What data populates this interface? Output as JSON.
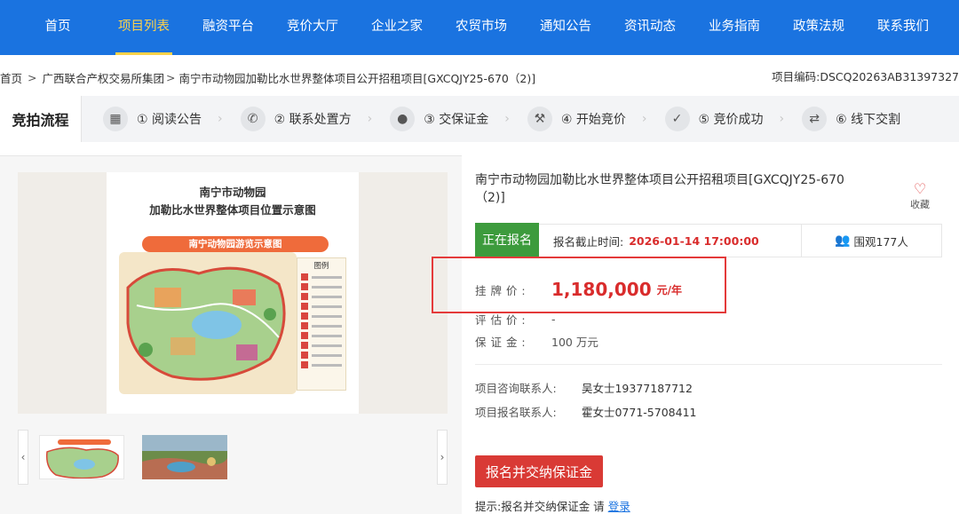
{
  "nav": {
    "items": [
      "首页",
      "项目列表",
      "融资平台",
      "竞价大厅",
      "企业之家",
      "农贸市场",
      "通知公告",
      "资讯动态",
      "业务指南",
      "政策法规",
      "联系我们"
    ],
    "active_index": 1
  },
  "breadcrumb": {
    "home": "首页",
    "group": "广西联合产权交易所集团",
    "current": "南宁市动物园加勒比水世界整体项目公开招租项目[GXCQJY25-670（2)]",
    "code": "项目编码:DSCQ20263AB31397327"
  },
  "flow": {
    "title": "竞拍流程",
    "steps": [
      {
        "label": "① 阅读公告",
        "icon": "announcement-icon"
      },
      {
        "label": "② 联系处置方",
        "icon": "phone-icon"
      },
      {
        "label": "③ 交保证金",
        "icon": "coins-icon"
      },
      {
        "label": "④ 开始竞价",
        "icon": "gavel-icon"
      },
      {
        "label": "⑤ 竞价成功",
        "icon": "check-icon"
      },
      {
        "label": "⑥ 线下交割",
        "icon": "exchange-icon"
      }
    ]
  },
  "gallery": {
    "main_title_line1": "南宁市动物园",
    "main_title_line2": "加勒比水世界整体项目位置示意图",
    "banner": "南宁动物园游览示意图",
    "legend_title": "图例",
    "prev_arrow": "‹",
    "next_arrow": "›"
  },
  "detail": {
    "title": "南宁市动物园加勒比水世界整体项目公开招租项目[GXCQJY25-670（2)]",
    "favorite_label": "收藏",
    "status": "正在报名",
    "deadline_label": "报名截止时间:",
    "deadline_value": "2026-01-14 17:00:00",
    "viewers": "围观177人",
    "listing_price_label": "挂 牌 价 :",
    "listing_price": "1,180,000",
    "price_unit": "元/年",
    "appraisal_label": "评 估 价 :",
    "appraisal_value": "-",
    "deposit_label": "保 证 金 :",
    "deposit_value": "100 万元",
    "consult_label": "项目咨询联系人:",
    "consult_value": "吴女士19377187712",
    "register_label": "项目报名联系人:",
    "register_value": "霍女士0771-5708411",
    "action_button": "报名并交纳保证金",
    "tip_text": "提示:报名并交纳保证金 请",
    "tip_login": "登录"
  },
  "colors": {
    "nav_bg": "#1a73e0",
    "accent": "#ffd24a",
    "status_green": "#3d9b3d",
    "price_red": "#d92c2c",
    "button_red": "#d93a35"
  }
}
